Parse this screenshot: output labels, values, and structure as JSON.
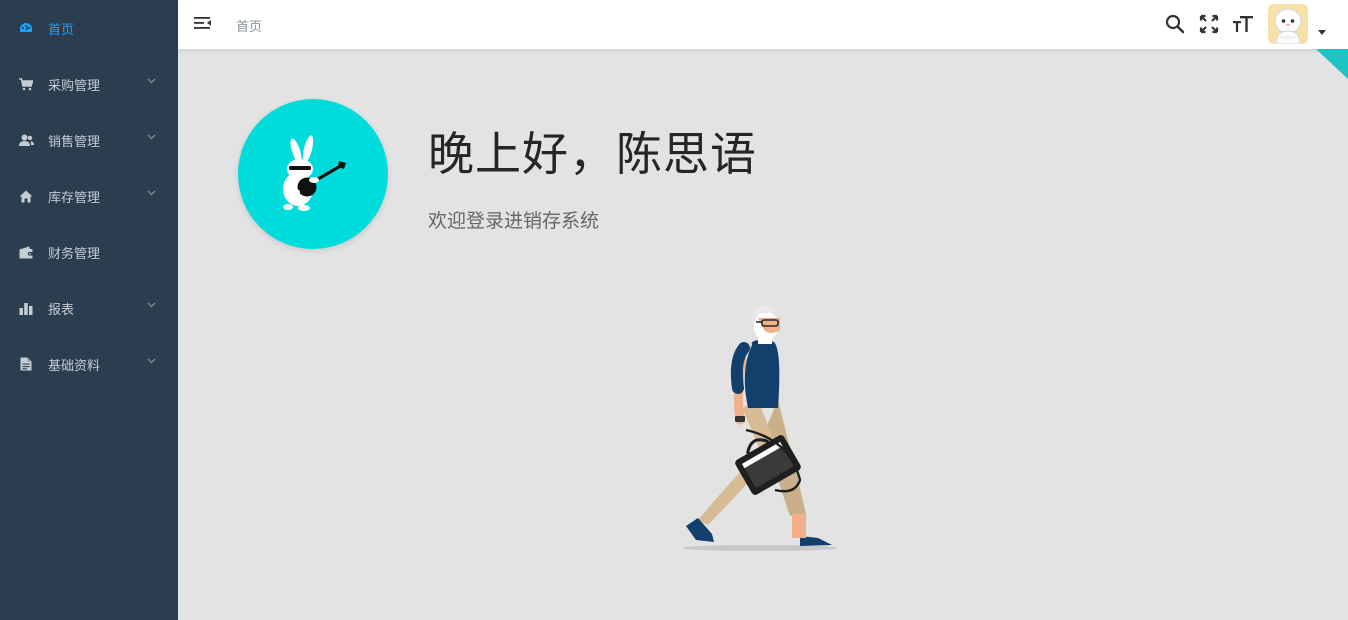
{
  "sidebar": {
    "items": [
      {
        "label": "首页",
        "icon": "dashboard-icon",
        "active": true
      },
      {
        "label": "采购管理",
        "icon": "cart-icon",
        "has_children": true
      },
      {
        "label": "销售管理",
        "icon": "users-icon",
        "has_children": true
      },
      {
        "label": "库存管理",
        "icon": "home-icon",
        "has_children": true
      },
      {
        "label": "财务管理",
        "icon": "wallet-icon",
        "has_children": false
      },
      {
        "label": "报表",
        "icon": "bar-chart-icon",
        "has_children": true
      },
      {
        "label": "基础资料",
        "icon": "document-icon",
        "has_children": true
      }
    ]
  },
  "header": {
    "breadcrumb": "首页",
    "icons": [
      "search-icon",
      "fullscreen-icon",
      "font-size-icon"
    ]
  },
  "main": {
    "greeting": "晚上好，陈思语",
    "welcome": "欢迎登录进销存系统"
  },
  "colors": {
    "sidebar_bg": "#2b3e50",
    "active": "#1e9fff",
    "logo_bg": "#00dcdc",
    "main_bg": "#e3e3e3"
  }
}
